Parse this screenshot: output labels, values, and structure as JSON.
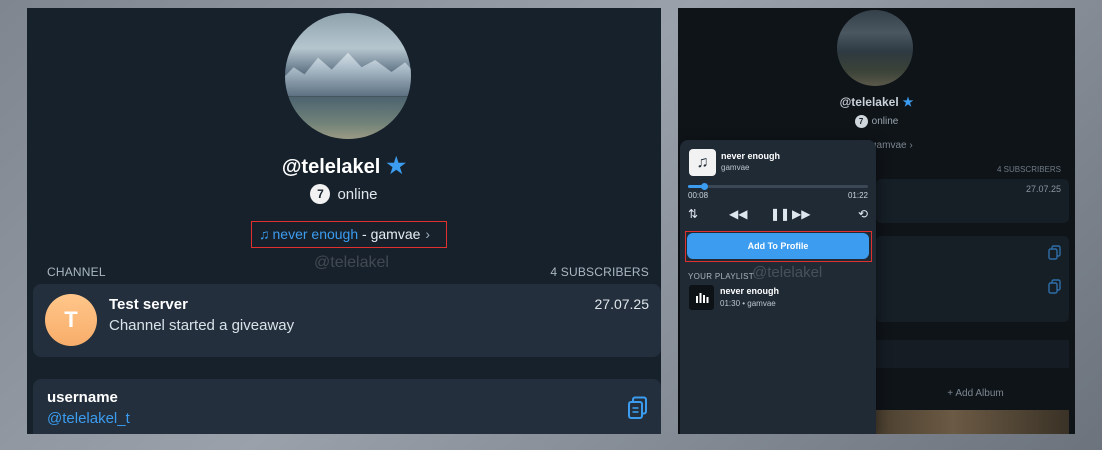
{
  "left": {
    "profile": {
      "name": "@telelakel"
    },
    "online_count": "7",
    "online_label": "online",
    "music": {
      "track": "never enough",
      "separator": " - ",
      "artist": "gamvae"
    },
    "watermark": "@telelakel",
    "section": {
      "left": "CHANNEL",
      "right": "4 SUBSCRIBERS"
    },
    "channel": {
      "initial": "T",
      "title": "Test server",
      "subtitle": "Channel started a giveaway",
      "date": "27.07.25"
    },
    "username": {
      "label": "username",
      "value": "@telelakel_t"
    }
  },
  "right": {
    "profile_name": "@telelakel",
    "online_count": "7",
    "online_label": "online",
    "music_peek": "gamvae",
    "subscribers": "4 SUBSCRIBERS",
    "date": "27.07.25",
    "add_album": "Add Album",
    "player": {
      "title": "never enough",
      "artist": "gamvae",
      "time_elapsed": "00:08",
      "time_total": "01:22",
      "progress_fraction": 0.09,
      "add_button": "Add To Profile",
      "watermark": "@telelakel",
      "playlist_header": "YOUR PLAYLIST",
      "playlist": [
        {
          "title": "never enough",
          "meta": "01:30 • gamvae"
        }
      ]
    }
  },
  "colors": {
    "accent": "#3b9cf0",
    "highlight_box": "#e0312e",
    "panel_bg": "#17212b",
    "card_bg": "#232f3c"
  },
  "icons": [
    "star-icon",
    "music-note-icon",
    "chevron-right-icon",
    "copy-icon",
    "sort-icon",
    "rewind-icon",
    "pause-icon",
    "forward-icon",
    "repeat-icon",
    "plus-icon"
  ]
}
